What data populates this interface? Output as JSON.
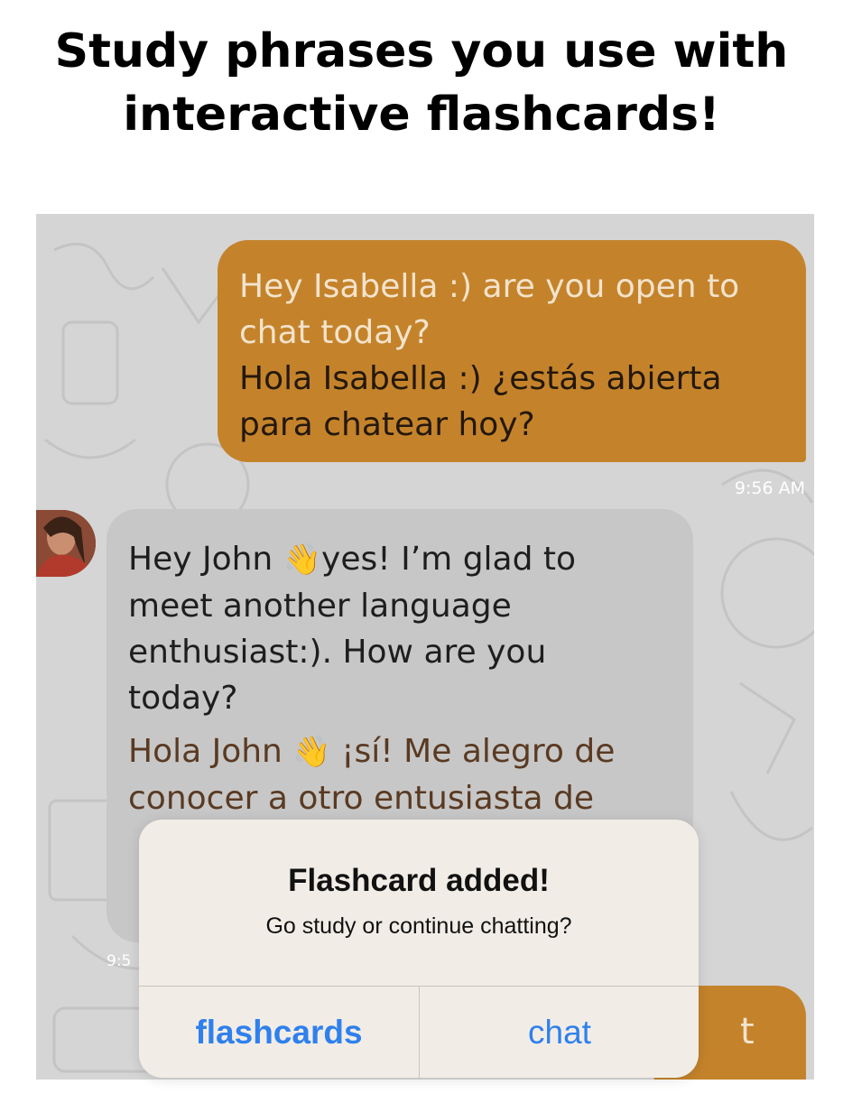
{
  "headline": {
    "line1": "Study phrases you use with",
    "line2": "interactive flashcards!"
  },
  "chat": {
    "outgoing_message": {
      "english_line1": "Hey Isabella :) are you open to",
      "english_line2": "chat today?",
      "spanish_line1": "Hola Isabella :) ¿estás abierta",
      "spanish_line2": "para chatear hoy?",
      "time": "9:56 AM"
    },
    "incoming_message": {
      "english_line1_a": "Hey John ",
      "english_line1_emoji": "👋",
      "english_line1_b": "yes!  I’m glad to",
      "english_line2": "meet another language",
      "english_line3": "enthusiast:). How are you",
      "english_line4": "today?",
      "spanish_line1_a": "Hola John ",
      "spanish_line1_emoji": "👋",
      "spanish_line1_b": " ¡sí! Me alegro de",
      "spanish_line2": "conocer a otro entusiasta de",
      "time": "9:5"
    },
    "partial_outgoing_fragment": "t"
  },
  "dialog": {
    "title": "Flashcard added!",
    "message": "Go study or continue chatting?",
    "primary_button": "flashcards",
    "secondary_button": "chat"
  },
  "colors": {
    "outgoing_bubble": "#c4832b",
    "incoming_bubble": "#c7c7c7",
    "chat_background": "#d5d5d5",
    "dialog_background": "#f1ede6",
    "button_text": "#2f80ed"
  }
}
